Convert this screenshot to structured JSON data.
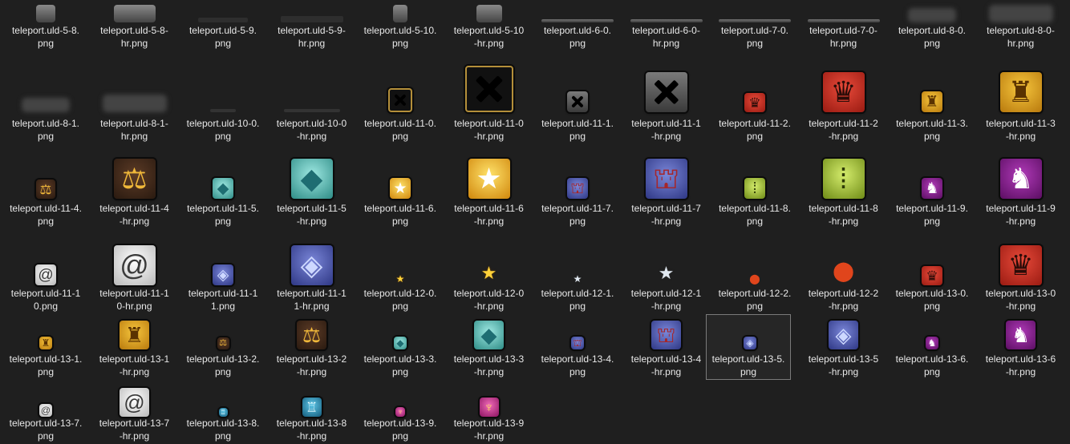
{
  "window": {
    "selected_file": "teleport.uld-13-5.png"
  },
  "files": [
    {
      "label": "teleport.uld-5-8.\npng",
      "icon": "gray-rounded-tab"
    },
    {
      "label": "teleport.uld-5-8-\nhr.png",
      "icon": "gray-rounded-tab"
    },
    {
      "label": "teleport.uld-5-9.\npng",
      "icon": "dark-bar"
    },
    {
      "label": "teleport.uld-5-9-\nhr.png",
      "icon": "dark-bar"
    },
    {
      "label": "teleport.uld-5-10.\npng",
      "icon": "gray-pill"
    },
    {
      "label": "teleport.uld-5-10\n-hr.png",
      "icon": "gray-pill"
    },
    {
      "label": "teleport.uld-6-0.\npng",
      "icon": "gray-line"
    },
    {
      "label": "teleport.uld-6-0-\nhr.png",
      "icon": "gray-line"
    },
    {
      "label": "teleport.uld-7-0.\npng",
      "icon": "gray-line"
    },
    {
      "label": "teleport.uld-7-0-\nhr.png",
      "icon": "gray-line"
    },
    {
      "label": "teleport.uld-8-0.\npng",
      "icon": "blurred-shadow"
    },
    {
      "label": "teleport.uld-8-0-\nhr.png",
      "icon": "blurred-shadow"
    },
    {
      "label": "teleport.uld-8-1.\npng",
      "icon": "blurred-shadow"
    },
    {
      "label": "teleport.uld-8-1-\nhr.png",
      "icon": "blurred-shadow"
    },
    {
      "label": "teleport.uld-10-0.\npng",
      "icon": "dark-line"
    },
    {
      "label": "teleport.uld-10-0\n-hr.png",
      "icon": "dark-line"
    },
    {
      "label": "teleport.uld-11-0.\npng",
      "icon": "close-x-gold"
    },
    {
      "label": "teleport.uld-11-0\n-hr.png",
      "icon": "close-x-gold"
    },
    {
      "label": "teleport.uld-11-1.\npng",
      "icon": "close-x-gray"
    },
    {
      "label": "teleport.uld-11-1\n-hr.png",
      "icon": "close-x-gray"
    },
    {
      "label": "teleport.uld-11-2.\npng",
      "icon": "red-crown-emblem"
    },
    {
      "label": "teleport.uld-11-2\n-hr.png",
      "icon": "red-crown-emblem"
    },
    {
      "label": "teleport.uld-11-3.\npng",
      "icon": "gold-crest"
    },
    {
      "label": "teleport.uld-11-3\n-hr.png",
      "icon": "gold-crest"
    },
    {
      "label": "teleport.uld-11-4.\npng",
      "icon": "gold-scales"
    },
    {
      "label": "teleport.uld-11-4\n-hr.png",
      "icon": "gold-scales"
    },
    {
      "label": "teleport.uld-11-5.\npng",
      "icon": "teal-crystal"
    },
    {
      "label": "teleport.uld-11-5\n-hr.png",
      "icon": "teal-crystal"
    },
    {
      "label": "teleport.uld-11-6.\npng",
      "icon": "yellow-star"
    },
    {
      "label": "teleport.uld-11-6\n-hr.png",
      "icon": "yellow-star"
    },
    {
      "label": "teleport.uld-11-7.\npng",
      "icon": "blue-castle"
    },
    {
      "label": "teleport.uld-11-7\n-hr.png",
      "icon": "blue-castle"
    },
    {
      "label": "teleport.uld-11-8.\npng",
      "icon": "lime-footprints"
    },
    {
      "label": "teleport.uld-11-8\n-hr.png",
      "icon": "lime-footprints"
    },
    {
      "label": "teleport.uld-11-9.\npng",
      "icon": "purple-griffin"
    },
    {
      "label": "teleport.uld-11-9\n-hr.png",
      "icon": "purple-griffin"
    },
    {
      "label": "teleport.uld-11-1\n0.png",
      "icon": "white-triskelion"
    },
    {
      "label": "teleport.uld-11-1\n0-hr.png",
      "icon": "white-triskelion"
    },
    {
      "label": "teleport.uld-11-1\n1.png",
      "icon": "blue-crystal"
    },
    {
      "label": "teleport.uld-11-1\n1-hr.png",
      "icon": "blue-crystal"
    },
    {
      "label": "teleport.uld-12-0.\npng",
      "icon": "small-gold-star"
    },
    {
      "label": "teleport.uld-12-0\n-hr.png",
      "icon": "small-gold-star"
    },
    {
      "label": "teleport.uld-12-1.\npng",
      "icon": "small-silver-star"
    },
    {
      "label": "teleport.uld-12-1\n-hr.png",
      "icon": "small-silver-star"
    },
    {
      "label": "teleport.uld-12-2.\npng",
      "icon": "orange-pin"
    },
    {
      "label": "teleport.uld-12-2\n-hr.png",
      "icon": "orange-pin"
    },
    {
      "label": "teleport.uld-13-0.\npng",
      "icon": "red-crown-emblem"
    },
    {
      "label": "teleport.uld-13-0\n-hr.png",
      "icon": "red-crown-emblem"
    },
    {
      "label": "teleport.uld-13-1.\npng",
      "icon": "gold-crest"
    },
    {
      "label": "teleport.uld-13-1\n-hr.png",
      "icon": "gold-crest"
    },
    {
      "label": "teleport.uld-13-2.\npng",
      "icon": "gold-scales"
    },
    {
      "label": "teleport.uld-13-2\n-hr.png",
      "icon": "gold-scales"
    },
    {
      "label": "teleport.uld-13-3.\npng",
      "icon": "teal-crystal"
    },
    {
      "label": "teleport.uld-13-3\n-hr.png",
      "icon": "teal-crystal"
    },
    {
      "label": "teleport.uld-13-4.\npng",
      "icon": "blue-castle"
    },
    {
      "label": "teleport.uld-13-4\n-hr.png",
      "icon": "blue-castle"
    },
    {
      "label": "teleport.uld-13-5.\npng",
      "icon": "blue-crystal"
    },
    {
      "label": "teleport.uld-13-5\n-hr.png",
      "icon": "blue-crystal"
    },
    {
      "label": "teleport.uld-13-6.\npng",
      "icon": "purple-griffin"
    },
    {
      "label": "teleport.uld-13-6\n-hr.png",
      "icon": "purple-griffin"
    },
    {
      "label": "teleport.uld-13-7.\npng",
      "icon": "white-triskelion"
    },
    {
      "label": "teleport.uld-13-7\n-hr.png",
      "icon": "white-triskelion"
    },
    {
      "label": "teleport.uld-13-8.\npng",
      "icon": "cyan-spire"
    },
    {
      "label": "teleport.uld-13-8\n-hr.png",
      "icon": "cyan-spire"
    },
    {
      "label": "teleport.uld-13-9.\npng",
      "icon": "pink-crest"
    },
    {
      "label": "teleport.uld-13-9\n-hr.png",
      "icon": "pink-crest"
    }
  ]
}
